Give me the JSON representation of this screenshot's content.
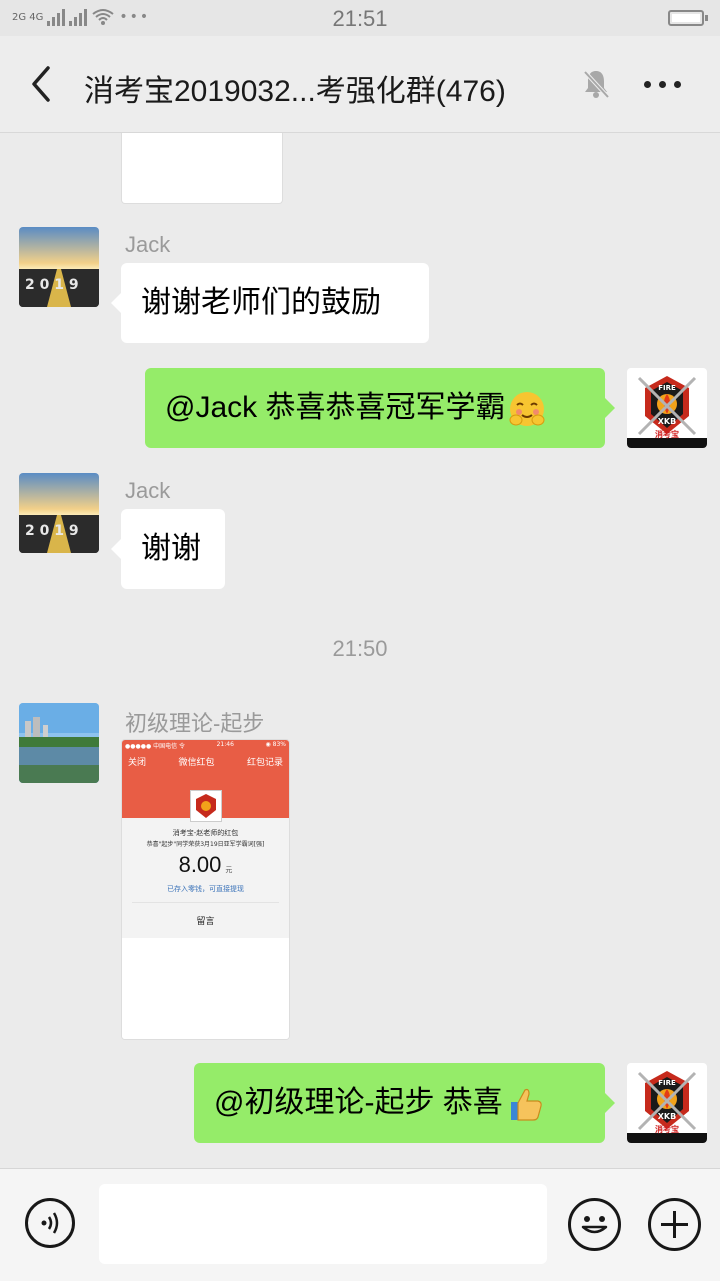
{
  "status_bar": {
    "left_text": "2G 4G",
    "time": "21:51"
  },
  "chat": {
    "title": "消考宝2019032...考强化群(476)",
    "muted_icon": "bell-muted-icon",
    "more_icon": "more-dots-icon"
  },
  "messages": [
    {
      "sender": "Jack",
      "text": "谢谢老师们的鼓励",
      "direction": "in",
      "avatar": "road-2019-avatar"
    },
    {
      "sender": "",
      "text": "@Jack  恭喜恭喜冠军学霸",
      "emoji": "cheeky-face-emoji",
      "direction": "out",
      "avatar": "xkb-fire-logo-avatar"
    },
    {
      "sender": "Jack",
      "text": "谢谢",
      "direction": "in",
      "avatar": "road-2019-avatar"
    },
    {
      "sender": "初级理论-起步",
      "type": "image",
      "direction": "in",
      "avatar": "river-city-avatar"
    },
    {
      "sender": "",
      "text": "@初级理论-起步  恭喜",
      "emoji": "thumbs-up-emoji",
      "direction": "out",
      "avatar": "xkb-fire-logo-avatar"
    }
  ],
  "timestamp": "21:50",
  "redpacket_screenshot": {
    "status_left": "●●●●● 中国电信 令",
    "status_time": "21:46",
    "status_right": "◉ 83%",
    "nav_close": "关闭",
    "nav_title": "微信红包",
    "nav_records": "红包记录",
    "sender_line": "消考宝-赵老师的红包",
    "blessing": "恭喜\"起步\"同学荣获3月19日亚军学霸词[强]",
    "amount": "8.00",
    "unit": "元",
    "note": "已存入零钱，可直接提现",
    "reply": "留言"
  },
  "logo": {
    "fire_text": "FIRE",
    "brand_text": "XKB",
    "caption": "消考宝"
  },
  "colors": {
    "outgoing_bubble": "#95ec69",
    "incoming_bubble": "#ffffff",
    "background": "#ebebeb",
    "redpacket_red": "#e85d45"
  },
  "input_bar": {
    "voice_icon": "voice-icon",
    "emoji_icon": "emoji-face-icon",
    "plus_icon": "plus-icon",
    "placeholder": ""
  }
}
